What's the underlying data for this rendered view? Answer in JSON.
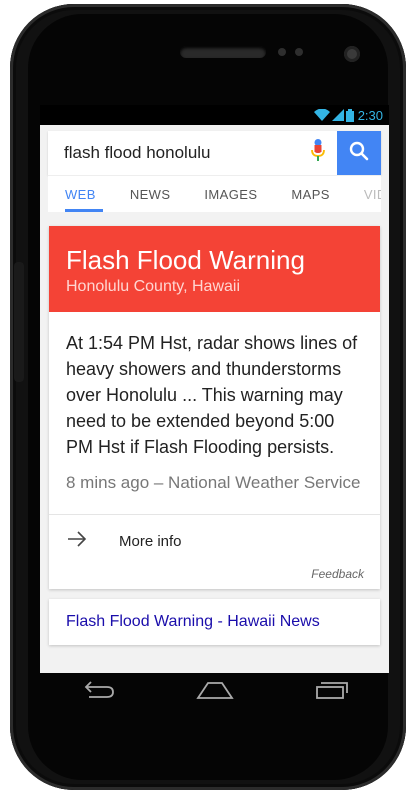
{
  "status_bar": {
    "time": "2:30"
  },
  "search": {
    "query": "flash flood honolulu"
  },
  "tabs": [
    {
      "label": "WEB",
      "active": true
    },
    {
      "label": "NEWS",
      "active": false
    },
    {
      "label": "IMAGES",
      "active": false
    },
    {
      "label": "MAPS",
      "active": false
    },
    {
      "label": "VIDE",
      "active": false
    }
  ],
  "alert": {
    "title": "Flash Flood Warning",
    "location": "Honolulu County, Hawaii",
    "body": "At 1:54 PM Hst, radar shows lines of heavy showers and thunderstorms over Honolulu ... This warning may need to be extended beyond 5:00 PM Hst if Flash Flooding persists.",
    "meta": "8 mins ago – National Weather Service",
    "more_info": "More info",
    "feedback": "Feedback"
  },
  "results": [
    {
      "title": "Flash Flood Warning - Hawaii News"
    }
  ],
  "colors": {
    "alert_red": "#f44336",
    "accent_blue": "#4285f4",
    "status_blue": "#33b5e5",
    "link_blue": "#1a0dab"
  },
  "icons": [
    "wifi-icon",
    "signal-icon",
    "battery-icon",
    "mic-icon",
    "search-icon",
    "arrow-right-icon",
    "back-icon",
    "home-icon",
    "recents-icon"
  ]
}
